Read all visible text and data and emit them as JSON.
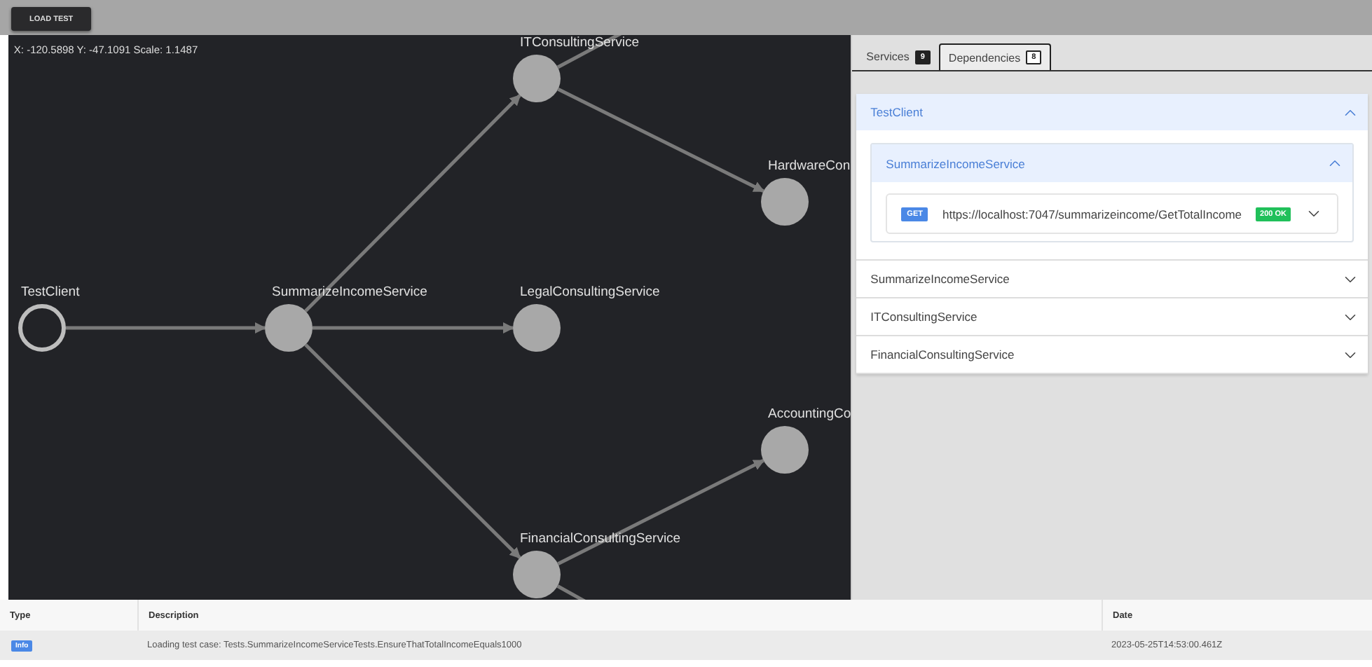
{
  "toolbar": {
    "load_button": "LOAD TEST"
  },
  "canvas": {
    "coordinates": "X: -120.5898 Y: -47.1091 Scale: 1.1487",
    "graph": [
      {
        "label": "TestClient",
        "kind": "client",
        "children": [
          {
            "label": "SummarizeIncomeService",
            "kind": "service",
            "children": [
              {
                "label": "ITConsultingService",
                "kind": "service",
                "children": [
                  {
                    "label": "HardwareCon",
                    "kind": "service"
                  }
                ]
              },
              {
                "label": "LegalConsultingService",
                "kind": "service"
              },
              {
                "label": "FinancialConsultingService",
                "kind": "service",
                "children": [
                  {
                    "label": "AccountingCo",
                    "kind": "service"
                  }
                ]
              }
            ]
          }
        ]
      }
    ]
  },
  "panel": {
    "tabs": [
      {
        "label": "Services",
        "count": "9",
        "selected": false
      },
      {
        "label": "Dependencies",
        "count": "8",
        "selected": true
      }
    ],
    "dependencies": [
      {
        "label": "TestClient",
        "expanded": true,
        "children": [
          {
            "label": "SummarizeIncomeService",
            "expanded": true,
            "requests": [
              {
                "method": "GET",
                "url": "https://localhost:7047/summarizeincome/GetTotalIncome",
                "status": "200 OK",
                "expanded": false
              }
            ]
          }
        ]
      },
      {
        "label": "SummarizeIncomeService",
        "expanded": false
      },
      {
        "label": "ITConsultingService",
        "expanded": false
      },
      {
        "label": "FinancialConsultingService",
        "expanded": false
      }
    ]
  },
  "log": {
    "columns": [
      "Type",
      "Description",
      "Date"
    ],
    "rows": [
      {
        "type": "Info",
        "description": "Loading test case: Tests.SummarizeIncomeServiceTests.EnsureThatTotalIncomeEquals1000",
        "date": "2023-05-25T14:53:00.461Z"
      }
    ]
  }
}
